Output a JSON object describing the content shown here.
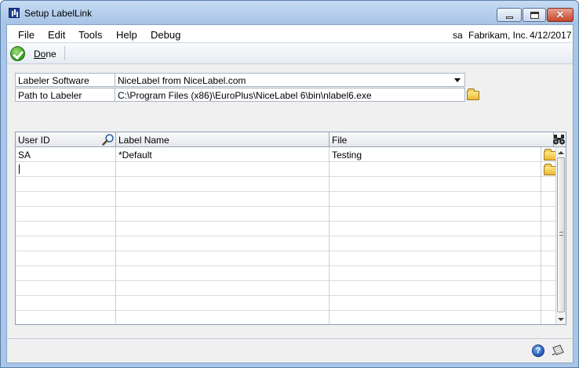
{
  "window": {
    "title": "Setup LabelLink",
    "close_glyph": "✕"
  },
  "menu": {
    "items": [
      "File",
      "Edit",
      "Tools",
      "Help",
      "Debug"
    ]
  },
  "status": {
    "user": "sa",
    "company": "Fabrikam, Inc.",
    "date": "4/12/2017"
  },
  "toolbar": {
    "done_label_underlined": "Do",
    "done_label_rest": "ne"
  },
  "fields": {
    "labeler_software_label": "Labeler Software",
    "labeler_software_value": "NiceLabel from NiceLabel.com",
    "path_label": "Path to Labeler",
    "path_value": "C:\\Program Files (x86)\\EuroPlus\\NiceLabel 6\\bin\\nlabel6.exe"
  },
  "grid": {
    "columns": [
      "User ID",
      "Label Name",
      "File"
    ],
    "rows": [
      {
        "user_id": "SA",
        "label_name": "*Default",
        "file": "Testing"
      },
      {
        "user_id": "",
        "label_name": "",
        "file": ""
      }
    ]
  },
  "icons": {
    "done": "check-circle-icon",
    "lookup": "magnifier-icon",
    "find": "binoculars-icon",
    "browse": "folder-icon",
    "help": "help-icon",
    "note": "note-icon"
  },
  "colors": {
    "window_frame": "#a9c6e8",
    "client_bg": "#f0f0f0",
    "done_green": "#2f9a1c",
    "folder_yellow": "#e9b934"
  },
  "help_glyph": "?"
}
